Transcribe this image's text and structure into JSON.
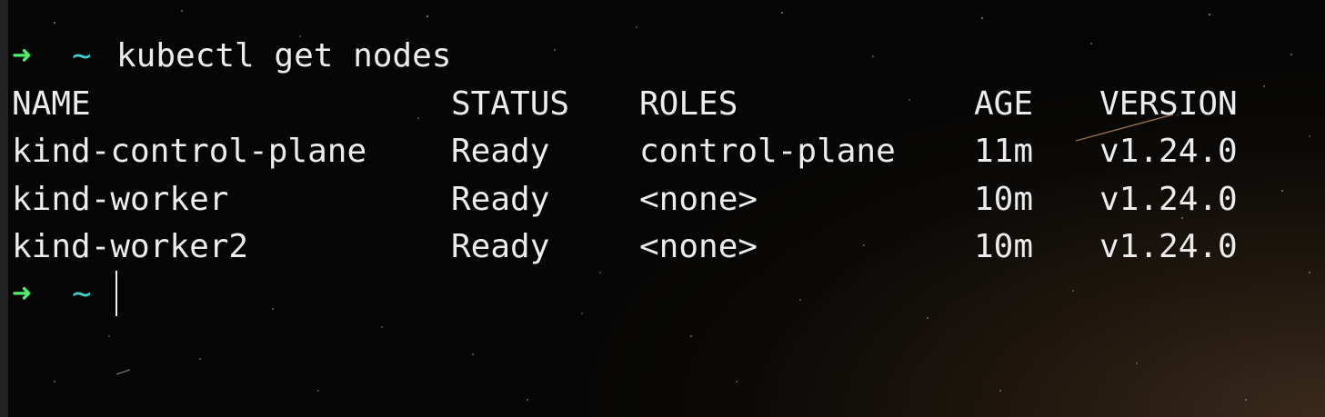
{
  "terminal": {
    "background_color": "#050505",
    "accent_colors": {
      "prompt_arrow": "#4ef06a",
      "prompt_dir": "#3fd0d0",
      "text": "#ececec"
    },
    "command_line": {
      "arrow": "➜",
      "dir": "~",
      "command": "kubectl get nodes"
    },
    "table": {
      "headers": [
        "NAME",
        "STATUS",
        "ROLES",
        "AGE",
        "VERSION"
      ],
      "rows": [
        [
          "kind-control-plane",
          "Ready",
          "control-plane",
          "11m",
          "v1.24.0"
        ],
        [
          "kind-worker",
          "Ready",
          "<none>",
          "10m",
          "v1.24.0"
        ],
        [
          "kind-worker2",
          "Ready",
          "<none>",
          "10m",
          "v1.24.0"
        ]
      ]
    },
    "prompt_line": {
      "arrow": "➜",
      "dir": "~"
    }
  }
}
